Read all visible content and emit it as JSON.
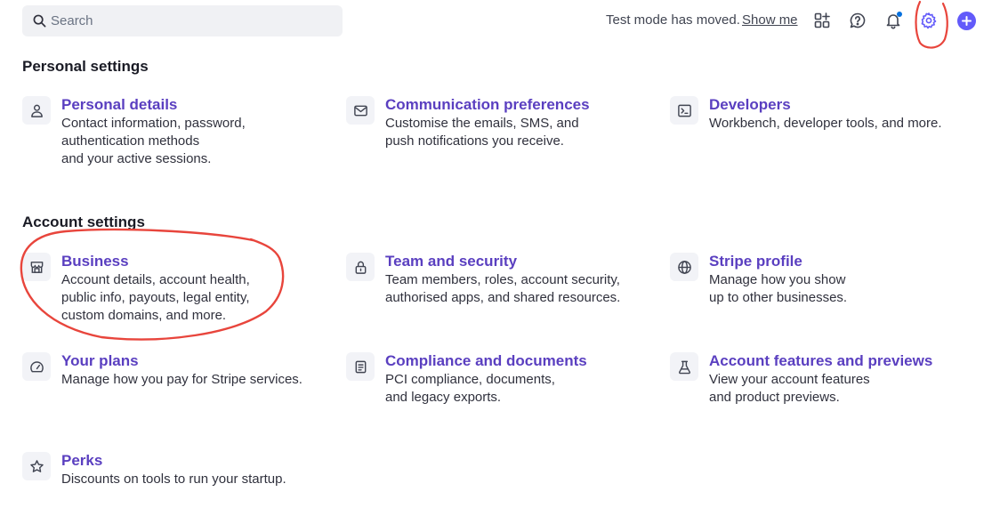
{
  "search": {
    "placeholder": "Search"
  },
  "header": {
    "notice": "Test mode has moved.",
    "show_me": "Show me"
  },
  "colors": {
    "accent": "#625afa",
    "link": "#5a3fc0",
    "annotation": "#e8453c"
  },
  "sections": {
    "personal": {
      "title": "Personal settings",
      "items": [
        {
          "icon": "person-icon",
          "title": "Personal details",
          "desc": "Contact information, password,\nauthentication methods\nand your active sessions."
        },
        {
          "icon": "mail-icon",
          "title": "Communication preferences",
          "desc": "Customise the emails, SMS, and\npush notifications you receive."
        },
        {
          "icon": "terminal-icon",
          "title": "Developers",
          "desc": "Workbench, developer tools, and more."
        }
      ]
    },
    "account": {
      "title": "Account settings",
      "items": [
        {
          "icon": "storefront-icon",
          "title": "Business",
          "desc": "Account details, account health,\npublic info, payouts, legal entity,\ncustom domains, and more."
        },
        {
          "icon": "lock-icon",
          "title": "Team and security",
          "desc": "Team members, roles, account security,\nauthorised apps, and shared resources."
        },
        {
          "icon": "globe-icon",
          "title": "Stripe profile",
          "desc": "Manage how you show\nup to other businesses."
        },
        {
          "icon": "gauge-icon",
          "title": "Your plans",
          "desc": "Manage how you pay for Stripe services."
        },
        {
          "icon": "document-icon",
          "title": "Compliance and documents",
          "desc": "PCI compliance, documents,\nand legacy exports."
        },
        {
          "icon": "flask-icon",
          "title": "Account features and previews",
          "desc": "View your account features\nand product previews."
        },
        {
          "icon": "star-icon",
          "title": "Perks",
          "desc": "Discounts on tools to run your startup."
        }
      ]
    }
  }
}
